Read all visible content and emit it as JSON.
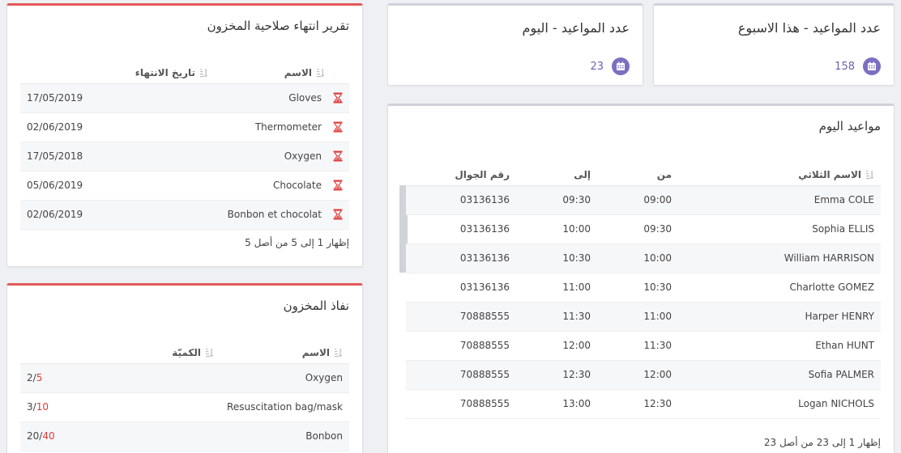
{
  "colors": {
    "accent": "#e25a5a",
    "purple": "#7b6fc2",
    "link": "#6c5fb0",
    "danger": "#e03c3c"
  },
  "stats": {
    "week": {
      "title": "عدد المواعيد - هذا الاسبوع",
      "value": "158",
      "icon": "calendar-icon"
    },
    "today": {
      "title": "عدد المواعيد - اليوم",
      "value": "23",
      "icon": "calendar-icon"
    }
  },
  "expiry": {
    "title": "تقرير انتهاء صلاحية المخزون",
    "columns": {
      "name": "الاسم",
      "date": "تاريخ الانتهاء"
    },
    "rows": [
      {
        "name": "Gloves",
        "date": "17/05/2019"
      },
      {
        "name": "Thermometer",
        "date": "02/06/2019"
      },
      {
        "name": "Oxygen",
        "date": "17/05/2018"
      },
      {
        "name": "Chocolate",
        "date": "05/06/2019"
      },
      {
        "name": "Bonbon et chocolat",
        "date": "02/06/2019"
      }
    ],
    "footer": "إظهار 1 إلى 5 من أصل 5"
  },
  "stock": {
    "title": "نفاذ المخزون",
    "columns": {
      "name": "الاسم",
      "qty": "الكميّة"
    },
    "rows": [
      {
        "name": "Oxygen",
        "have": "2",
        "need": "5"
      },
      {
        "name": "Resuscitation bag/mask",
        "have": "3",
        "need": "10"
      },
      {
        "name": "Bonbon",
        "have": "20",
        "need": "40"
      }
    ]
  },
  "appointments": {
    "title": "مواعيد اليوم",
    "columns": {
      "name": "الاسم الثلاثي",
      "from": "من",
      "to": "إلى",
      "mobile": "رقم الجوال"
    },
    "rows": [
      {
        "name": "Emma COLE",
        "from": "09:00",
        "to": "09:30",
        "mobile": "03136136"
      },
      {
        "name": "Sophia ELLIS",
        "from": "09:30",
        "to": "10:00",
        "mobile": "03136136"
      },
      {
        "name": "William HARRISON",
        "from": "10:00",
        "to": "10:30",
        "mobile": "03136136"
      },
      {
        "name": "Charlotte GOMEZ",
        "from": "10:30",
        "to": "11:00",
        "mobile": "03136136"
      },
      {
        "name": "Harper HENRY",
        "from": "11:00",
        "to": "11:30",
        "mobile": "70888555"
      },
      {
        "name": "Ethan HUNT",
        "from": "11:30",
        "to": "12:00",
        "mobile": "70888555"
      },
      {
        "name": "Sofia PALMER",
        "from": "12:00",
        "to": "12:30",
        "mobile": "70888555"
      },
      {
        "name": "Logan NICHOLS",
        "from": "12:30",
        "to": "13:00",
        "mobile": "70888555"
      }
    ],
    "footer": "إظهار 1 إلى 23 من أصل 23"
  }
}
